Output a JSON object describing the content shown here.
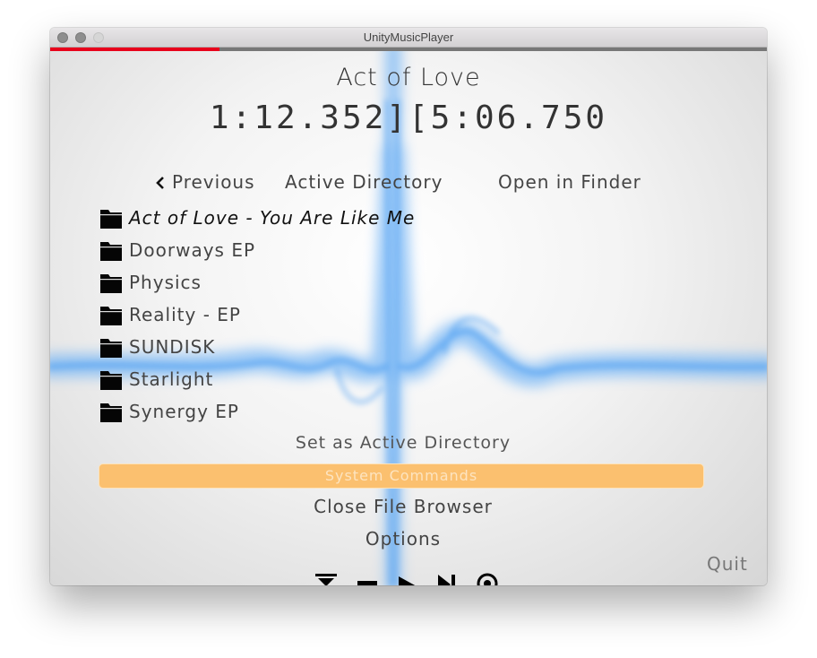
{
  "window": {
    "title": "UnityMusicPlayer"
  },
  "playback": {
    "track_title": "Act of Love",
    "time_display": "1:12.352][5:06.750",
    "progress": 0.236
  },
  "nav": {
    "previous_label": "Previous",
    "active_directory_label": "Active Directory",
    "open_in_finder_label": "Open in Finder"
  },
  "folders": [
    {
      "label": "Act of Love - You Are Like Me",
      "selected": true
    },
    {
      "label": "Doorways EP",
      "selected": false
    },
    {
      "label": "Physics",
      "selected": false
    },
    {
      "label": "Reality - EP",
      "selected": false
    },
    {
      "label": "SUNDISK",
      "selected": false
    },
    {
      "label": "Starlight",
      "selected": false
    },
    {
      "label": "Synergy EP",
      "selected": false
    }
  ],
  "actions": {
    "set_active_directory": "Set as Active Directory",
    "system_commands": "System Commands",
    "close_file_browser": "Close File Browser",
    "options": "Options",
    "quit": "Quit"
  },
  "icons": {
    "folder": "folder-icon",
    "previous": "chevron-left-icon",
    "controls": [
      "skip-to-start-icon",
      "stop-icon",
      "play-icon",
      "next-icon",
      "repeat-icon"
    ]
  },
  "colors": {
    "progress": "#e8001c",
    "system_commands_bg": "#fbc06f",
    "visualizer": "#7ab8f5"
  }
}
